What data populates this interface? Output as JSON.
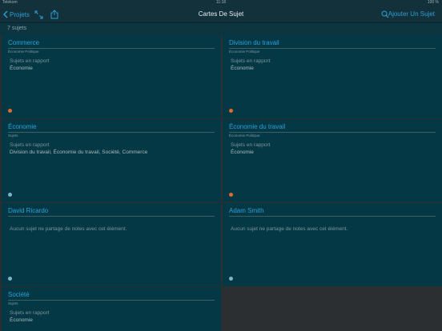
{
  "status": {
    "carrier": "Telekom",
    "time": "11:18",
    "battery": "100 %"
  },
  "nav": {
    "back_label": "Projets",
    "title": "Cartes De Sujet",
    "add_label": "Ajouter Un Sujet"
  },
  "subheader": {
    "count": "7 sujets"
  },
  "colors": {
    "accent": "#2aa0d8",
    "dot_orange": "#e26a2c",
    "dot_blue": "#7fb2cc"
  },
  "cards": [
    {
      "title": "Commerce",
      "type": "Économie Politique",
      "related_heading": "Sujets en rapport",
      "related_items": "Économie",
      "dot_color": "#e26a2c"
    },
    {
      "title": "Division du travail",
      "type": "Économie Politique",
      "related_heading": "Sujets en rapport",
      "related_items": "Économie",
      "dot_color": "#e26a2c"
    },
    {
      "title": "Économie",
      "type": "Sujets",
      "related_heading": "Sujets en rapport",
      "related_items": "Division du travail, Économie du travail, Société, Commerce",
      "dot_color": "#7fb2cc"
    },
    {
      "title": "Économie du travail",
      "type": "Économie Politique",
      "related_heading": "Sujets en rapport",
      "related_items": "Économie",
      "dot_color": "#e26a2c"
    },
    {
      "title": "David Ricardo",
      "type": "",
      "empty_message": "Aucun sujet ne partage de notes avec cet élément.",
      "dot_color": "#7fb2cc"
    },
    {
      "title": "Adam Smith",
      "type": "",
      "empty_message": "Aucun sujet ne partage de notes avec cet élément.",
      "dot_color": "#7fb2cc"
    },
    {
      "title": "Société",
      "type": "Sujets",
      "related_heading": "Sujets en rapport",
      "related_items": "Économie",
      "dot_color": "#7fb2cc"
    }
  ]
}
